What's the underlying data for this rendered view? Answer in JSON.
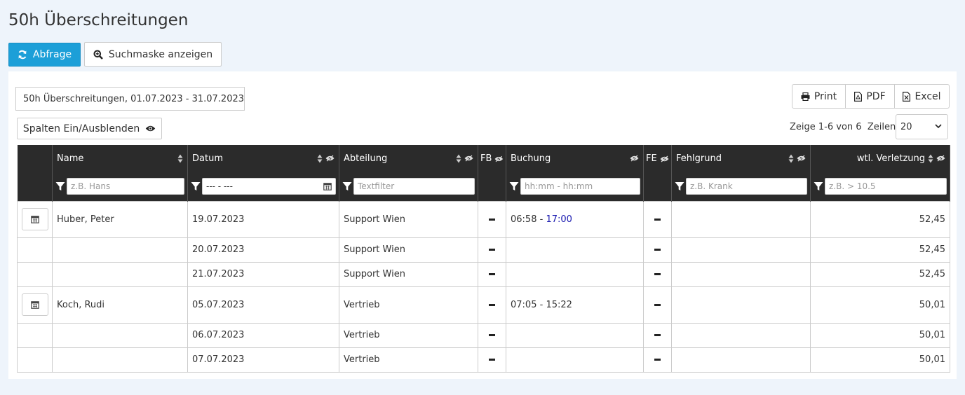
{
  "page_title": "50h Überschreitungen",
  "toolbar": {
    "query_label": "Abfrage",
    "search_mask_label": "Suchmaske anzeigen"
  },
  "report_label": "50h Überschreitungen, 01.07.2023 - 31.07.2023",
  "columns_toggle_label": "Spalten Ein/Ausblenden",
  "export": {
    "print": "Print",
    "pdf": "PDF",
    "excel": "Excel"
  },
  "pagination": {
    "info": "Zeige 1-6 von 6",
    "rows_label": "Zeilen",
    "rows_value": "20"
  },
  "columns": {
    "name": "Name",
    "datum": "Datum",
    "abteilung": "Abteilung",
    "fb": "FB",
    "buchung": "Buchung",
    "fe": "FE",
    "fehlgrund": "Fehlgrund",
    "verletzung": "wtl. Verletzung"
  },
  "filters": {
    "name": "z.B. Hans",
    "datum": "--- - ---",
    "abteilung": "Textfilter",
    "buchung": "hh:mm - hh:mm",
    "fehlgrund": "z.B. Krank",
    "verletzung": "z.B. > 10.5"
  },
  "rows": [
    {
      "name": "Huber, Peter",
      "datum": "19.07.2023",
      "abteilung": "Support Wien",
      "buchung_from": "06:58",
      "buchung_sep": " - ",
      "buchung_to": "17:00",
      "fehlgrund": "",
      "verletzung": "52,45"
    },
    {
      "name": "",
      "datum": "20.07.2023",
      "abteilung": "Support Wien",
      "buchung_from": "",
      "buchung_sep": "",
      "buchung_to": "",
      "fehlgrund": "",
      "verletzung": "52,45"
    },
    {
      "name": "",
      "datum": "21.07.2023",
      "abteilung": "Support Wien",
      "buchung_from": "",
      "buchung_sep": "",
      "buchung_to": "",
      "fehlgrund": "",
      "verletzung": "52,45"
    },
    {
      "name": "Koch, Rudi",
      "datum": "05.07.2023",
      "abteilung": "Vertrieb",
      "buchung_from": "07:05",
      "buchung_sep": " - ",
      "buchung_to": "15:22",
      "fehlgrund": "",
      "verletzung": "50,01"
    },
    {
      "name": "",
      "datum": "06.07.2023",
      "abteilung": "Vertrieb",
      "buchung_from": "",
      "buchung_sep": "",
      "buchung_to": "",
      "fehlgrund": "",
      "verletzung": "50,01"
    },
    {
      "name": "",
      "datum": "07.07.2023",
      "abteilung": "Vertrieb",
      "buchung_from": "",
      "buchung_sep": "",
      "buchung_to": "",
      "fehlgrund": "",
      "verletzung": "50,01"
    }
  ],
  "colors": {
    "primary": "#1c9fd8",
    "header_bg": "#2b2b2b",
    "page_bg": "#eef4fb",
    "booking_late": "#1a1ab0"
  }
}
